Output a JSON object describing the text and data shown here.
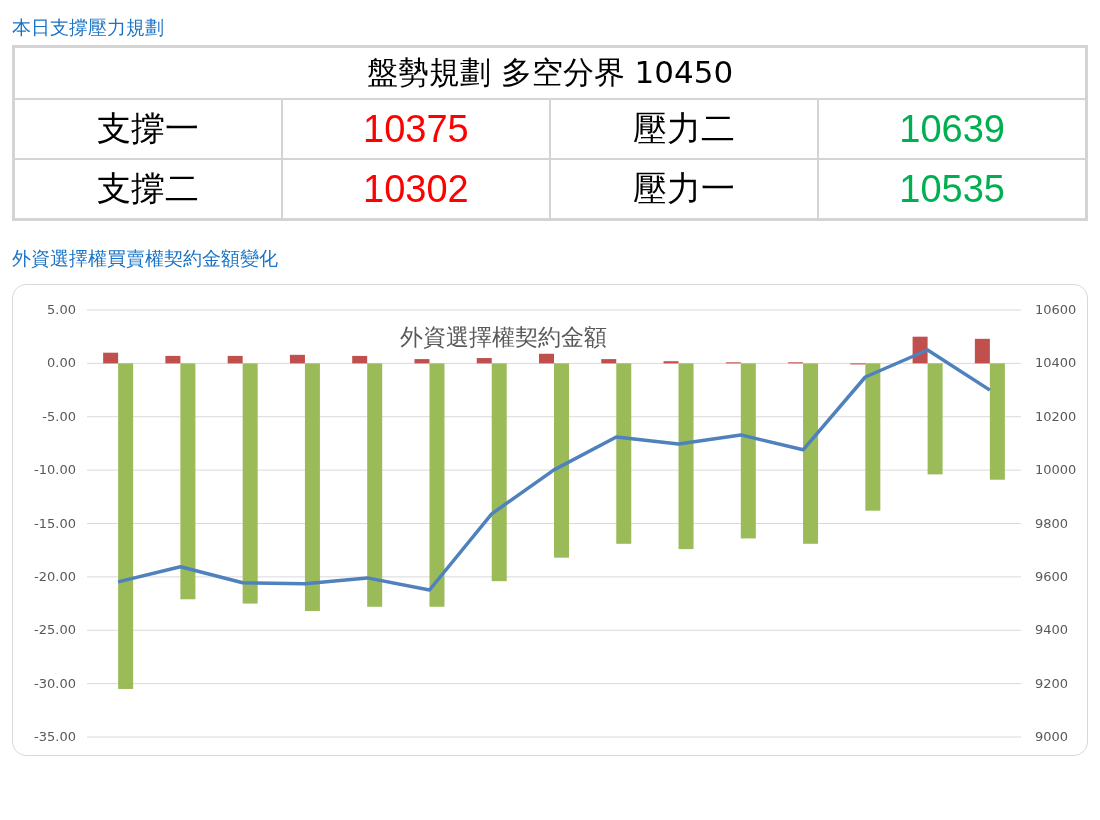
{
  "sections": [
    {
      "title": "本日支撐壓力規劃"
    },
    {
      "title": "外資選擇權買賣權契約金額變化"
    }
  ],
  "plan_table": {
    "header": "盤勢規劃 多空分界 10450",
    "rows": [
      {
        "cells": [
          {
            "text": "支撐一"
          },
          {
            "text": "10375",
            "color": "#ff0000"
          },
          {
            "text": "壓力二"
          },
          {
            "text": "10639",
            "color": "#00b050"
          }
        ]
      },
      {
        "cells": [
          {
            "text": "支撐二"
          },
          {
            "text": "10302",
            "color": "#ff0000"
          },
          {
            "text": "壓力一"
          },
          {
            "text": "10535",
            "color": "#00b050"
          }
        ]
      }
    ]
  },
  "chart": {
    "chart_data": {
      "type": "bar",
      "title": "外資選擇權契約金額",
      "grid": true,
      "ylim": [
        -35,
        5
      ],
      "y2lim": [
        9000,
        10600
      ],
      "yticks": [
        {
          "value": 5,
          "label": "5.00"
        },
        {
          "value": 0,
          "label": "0.00"
        },
        {
          "value": -5,
          "label": "-5.00"
        },
        {
          "value": -10,
          "label": "-10.00"
        },
        {
          "value": -15,
          "label": "-15.00"
        },
        {
          "value": -20,
          "label": "-20.00"
        },
        {
          "value": -25,
          "label": "-25.00"
        },
        {
          "value": -30,
          "label": "-30.00"
        },
        {
          "value": -35,
          "label": "-35.00"
        }
      ],
      "y2ticks": [
        10600,
        10400,
        10200,
        10000,
        9800,
        9600,
        9400,
        9200,
        9000
      ],
      "series": [
        {
          "color": "#c0504d",
          "values": [
            1.0,
            0.7,
            0.7,
            0.8,
            0.7,
            0.4,
            0.5,
            0.9,
            0.4,
            0.2,
            0.1,
            0.1,
            -0.1,
            2.5,
            2.3
          ]
        },
        {
          "color": "#9bbb59",
          "values": [
            -30.5,
            -22.1,
            -22.5,
            -23.2,
            -22.8,
            -22.8,
            -20.4,
            -18.2,
            -16.9,
            -17.4,
            -16.4,
            -16.9,
            -13.8,
            -10.4,
            -10.9
          ]
        },
        {
          "type": "line",
          "axis": "y2",
          "color": "#4f81bd",
          "values": [
            9581,
            9638,
            9578,
            9574,
            9596,
            9551,
            9836,
            10001,
            10124,
            10098,
            10132,
            10076,
            10349,
            10450,
            10300
          ]
        }
      ]
    }
  }
}
